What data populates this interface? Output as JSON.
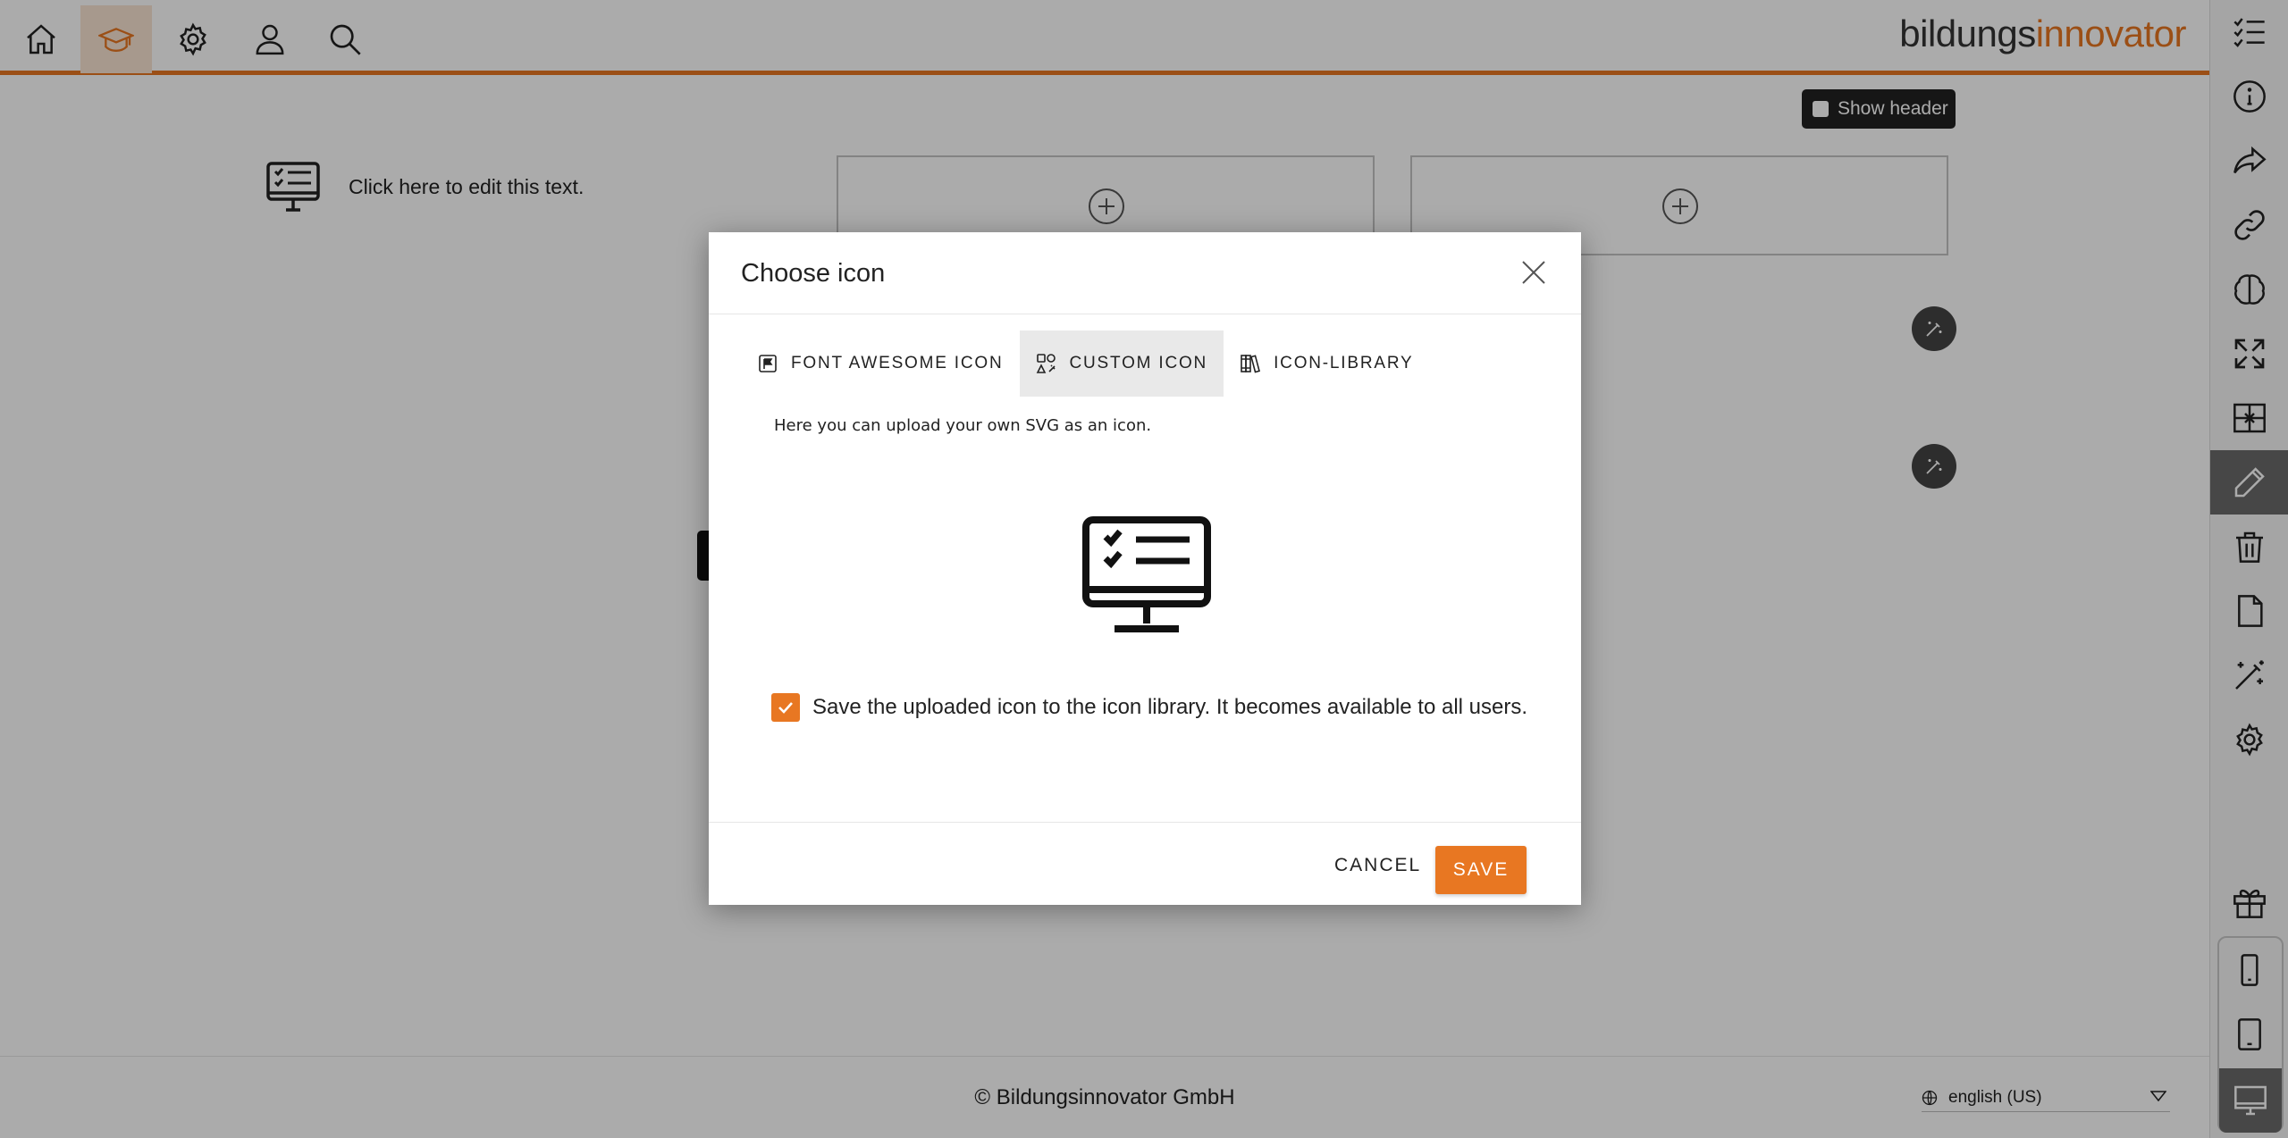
{
  "header": {
    "brand_part1": "bildungs",
    "brand_part2": "innovator",
    "nav_icons": [
      "home-icon",
      "graduation-cap-icon",
      "gear-icon",
      "user-icon",
      "search-icon"
    ],
    "active_nav": "graduation-cap-icon"
  },
  "canvas": {
    "show_header_label": "Show header",
    "show_header_checked": false,
    "content_text": "Click here to edit this text."
  },
  "footer": {
    "copyright": "© Bildungsinnovator GmbH",
    "language": "english (US)"
  },
  "sidebar": {
    "icons": [
      "checklist-icon",
      "info-icon",
      "share-icon",
      "link-icon",
      "brain-icon",
      "expand-icon",
      "layout-grid-icon",
      "pencil-icon",
      "trash-icon",
      "file-icon",
      "magic-wand-icon",
      "gear-icon",
      "gift-icon",
      "phone-icon",
      "tablet-icon",
      "desktop-icon"
    ],
    "active": [
      "pencil-icon",
      "desktop-icon"
    ]
  },
  "modal": {
    "title": "Choose icon",
    "tabs": [
      {
        "label": "FONT AWESOME ICON",
        "icon": "flag-square-icon",
        "active": false
      },
      {
        "label": "CUSTOM ICON",
        "icon": "custom-icons-icon",
        "active": true
      },
      {
        "label": "ICON-LIBRARY",
        "icon": "books-icon",
        "active": false
      }
    ],
    "description": "Here you can upload your own SVG as an icon.",
    "preview_icon": "monitor-checklist-icon",
    "save_to_library_label": "Save the uploaded icon to the icon library. It becomes available to all users.",
    "save_to_library_checked": true,
    "cancel_label": "CANCEL",
    "save_label": "SAVE"
  },
  "colors": {
    "accent": "#e87722",
    "overlay": "rgba(0,0,0,0.33)",
    "sidebar_active": "#6b6b6b"
  }
}
